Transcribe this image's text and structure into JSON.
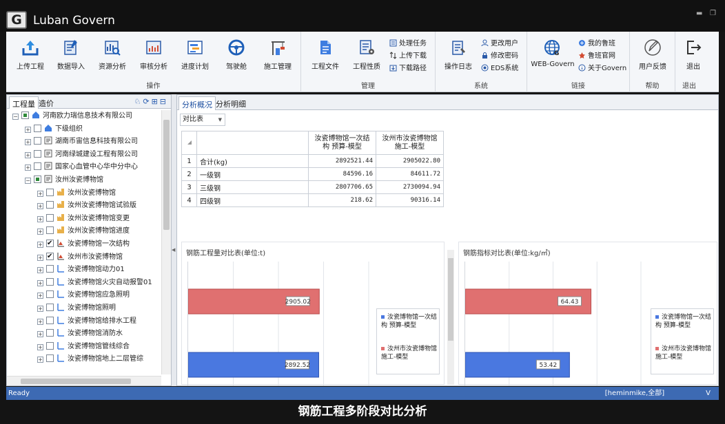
{
  "app": {
    "title": "Luban Govern",
    "logo_letter": "G"
  },
  "ribbon": {
    "groups": [
      {
        "label": "操作",
        "buttons": [
          "上传工程",
          "数据导入",
          "资源分析",
          "审核分析",
          "进度计划",
          "驾驶舱",
          "施工管理"
        ]
      },
      {
        "label": "管理",
        "buttons": [
          "工程文件",
          "工程性质"
        ],
        "small": [
          "处理任务",
          "上传下载",
          "下载路径"
        ]
      },
      {
        "label": "系统",
        "buttons": [
          "操作日志"
        ],
        "small": [
          "更改用户",
          "修改密码",
          "EDS系统"
        ]
      },
      {
        "label": "链接",
        "buttons": [
          "WEB-Govern"
        ],
        "small": [
          "我的鲁班",
          "鲁班官网",
          "关于Govern"
        ]
      },
      {
        "label": "帮助",
        "buttons": [
          "用户反馈"
        ]
      },
      {
        "label": "退出",
        "buttons": [
          "退出"
        ]
      }
    ]
  },
  "left": {
    "tabs": [
      "工程量",
      "造价"
    ],
    "tree": [
      {
        "label": "河南欧力瑞信息技术有限公司",
        "level": 0,
        "exp": "−",
        "chk": "partial",
        "icon": "home-icon"
      },
      {
        "label": "下级组织",
        "level": 1,
        "exp": "+",
        "chk": "none",
        "icon": "home-icon"
      },
      {
        "label": "湖南币宙信息科技有限公司",
        "level": 1,
        "exp": "+",
        "chk": "none",
        "icon": "company-icon"
      },
      {
        "label": "河南绿城建设工程有限公司",
        "level": 1,
        "exp": "+",
        "chk": "none",
        "icon": "company-icon"
      },
      {
        "label": "国家心血管中心华中分中心",
        "level": 1,
        "exp": "+",
        "chk": "none",
        "icon": "company-icon"
      },
      {
        "label": "汝州汝瓷博物馆",
        "level": 1,
        "exp": "−",
        "chk": "partial",
        "icon": "company-icon"
      },
      {
        "label": "汝州汝瓷博物馆",
        "level": 2,
        "exp": "+",
        "chk": "none",
        "icon": "project-icon"
      },
      {
        "label": "汝州汝瓷博物馆试验版",
        "level": 2,
        "exp": "+",
        "chk": "none",
        "icon": "project-icon"
      },
      {
        "label": "汝州汝瓷博物馆变更",
        "level": 2,
        "exp": "+",
        "chk": "none",
        "icon": "project-icon"
      },
      {
        "label": "汝州汝瓷博物馆进度",
        "level": 2,
        "exp": "+",
        "chk": "none",
        "icon": "project-icon"
      },
      {
        "label": "汝瓷博物馆一次结构",
        "level": 2,
        "exp": "+",
        "chk": "checked",
        "icon": "model-red-icon"
      },
      {
        "label": "汝州市汝瓷博物馆",
        "level": 2,
        "exp": "+",
        "chk": "checked",
        "icon": "model-red-icon"
      },
      {
        "label": "汝瓷博物馆动力01",
        "level": 2,
        "exp": "+",
        "chk": "none",
        "icon": "model-blue-icon"
      },
      {
        "label": "汝瓷博物馆火灾自动报警01",
        "level": 2,
        "exp": "+",
        "chk": "none",
        "icon": "model-blue-icon"
      },
      {
        "label": "汝瓷博物馆应急照明",
        "level": 2,
        "exp": "+",
        "chk": "none",
        "icon": "model-blue-icon"
      },
      {
        "label": "汝瓷博物馆照明",
        "level": 2,
        "exp": "+",
        "chk": "none",
        "icon": "model-blue-icon"
      },
      {
        "label": "汝瓷博物馆给排水工程",
        "level": 2,
        "exp": "+",
        "chk": "none",
        "icon": "model-blue-icon"
      },
      {
        "label": "汝瓷博物馆消防水",
        "level": 2,
        "exp": "+",
        "chk": "none",
        "icon": "model-blue-icon"
      },
      {
        "label": "汝瓷博物馆管线综合",
        "level": 2,
        "exp": "+",
        "chk": "none",
        "icon": "model-blue-icon"
      },
      {
        "label": "汝瓷博物馆地上二层管综",
        "level": 2,
        "exp": "+",
        "chk": "none",
        "icon": "model-blue-icon"
      }
    ]
  },
  "right": {
    "tabs": [
      "分析概况",
      "分析明细"
    ],
    "select_value": "对比表",
    "table": {
      "headers": [
        "汝瓷博物馆一次结构 预算-模型",
        "汝州市汝瓷博物馆 施工-模型"
      ],
      "rows": [
        {
          "idx": "1",
          "name": "合计(kg)",
          "a": "2892521.44",
          "b": "2905022.80"
        },
        {
          "idx": "2",
          "name": "一级钢",
          "a": "84596.16",
          "b": "84611.72"
        },
        {
          "idx": "3",
          "name": "三级钢",
          "a": "2807706.65",
          "b": "2730094.94"
        },
        {
          "idx": "4",
          "name": "四级钢",
          "a": "218.62",
          "b": "90316.14"
        }
      ]
    }
  },
  "chart_data": [
    {
      "type": "bar",
      "title": "钢筋工程量对比表(单位:t)",
      "series": [
        {
          "name": "汝瓷博物馆一次结构 预算-模型",
          "values": [
            2892.52
          ],
          "color": "#4a78e0"
        },
        {
          "name": "汝州市汝瓷博物馆 施工-模型",
          "values": [
            2905.02
          ],
          "color": "#e07070"
        }
      ],
      "xlim": [
        0,
        4000
      ],
      "legend": "right"
    },
    {
      "type": "bar",
      "title": "钢筋指标对比表(单位:kg/㎡)",
      "series": [
        {
          "name": "汝瓷博物馆一次结构 预算-模型",
          "values": [
            53.42
          ],
          "color": "#4a78e0"
        },
        {
          "name": "汝州市汝瓷博物馆 施工-模型",
          "values": [
            64.43
          ],
          "color": "#e07070"
        }
      ],
      "xlim": [
        0,
        90
      ],
      "legend": "right"
    }
  ],
  "status": {
    "left": "Ready",
    "right": "[heminmike,全部]",
    "edge": "V"
  },
  "caption": "钢筋工程多阶段对比分析"
}
